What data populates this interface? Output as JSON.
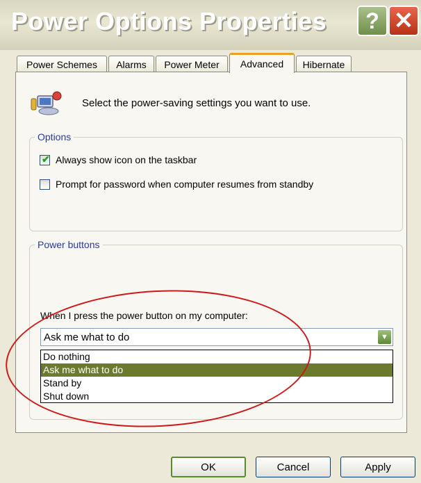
{
  "window": {
    "title": "Power Options Properties",
    "help_label": "?",
    "close_label": "✕"
  },
  "tabs": [
    {
      "label": "Power Schemes"
    },
    {
      "label": "Alarms"
    },
    {
      "label": "Power Meter"
    },
    {
      "label": "Advanced"
    },
    {
      "label": "Hibernate"
    }
  ],
  "active_tab": "Advanced",
  "intro_text": "Select the power-saving settings you want to use.",
  "options_group": {
    "legend": "Options",
    "items": [
      {
        "label": "Always show icon on the taskbar",
        "checked": true
      },
      {
        "label": "Prompt for password when computer resumes from standby",
        "checked": false
      }
    ]
  },
  "power_buttons_group": {
    "legend": "Power buttons",
    "prompt": "When I press the power button on my computer:",
    "selected_value": "Ask me what to do",
    "options": [
      {
        "label": "Do nothing"
      },
      {
        "label": "Ask me what to do"
      },
      {
        "label": "Stand by"
      },
      {
        "label": "Shut down"
      }
    ]
  },
  "buttons": {
    "ok": "OK",
    "cancel": "Cancel",
    "apply": "Apply"
  },
  "colors": {
    "active_tab_accent": "#e8a02b",
    "selection_highlight": "#6b7a2c",
    "annotation_circle": "#d01818",
    "group_legend_text": "#2a3a9c"
  },
  "icons": {
    "app_icon": "power-options-icon",
    "dropdown_arrow": "chevron-down-icon",
    "checkmark": "checkmark-icon"
  }
}
